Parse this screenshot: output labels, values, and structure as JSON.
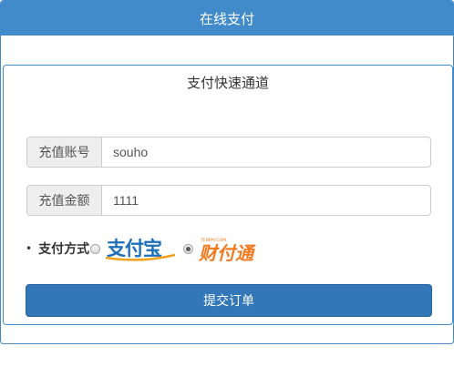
{
  "header": {
    "title": "在线支付"
  },
  "form": {
    "title": "支付快速通道",
    "account": {
      "label": "充值账号",
      "value": "souho"
    },
    "amount": {
      "label": "充值金额",
      "value": "1111"
    },
    "payment": {
      "label": "支付方式",
      "options": [
        {
          "name": "alipay",
          "logo_text": "支付宝",
          "selected": false
        },
        {
          "name": "tenpay",
          "logo_text": "财付通",
          "logo_subtext": "TENPAY.COM",
          "selected": true
        }
      ]
    },
    "submit_label": "提交订单"
  },
  "colors": {
    "primary": "#428bca",
    "button": "#3277b8",
    "alipay_blue": "#1c6fb8",
    "alipay_orange": "#f0a21b",
    "tenpay_orange": "#f47a20"
  }
}
